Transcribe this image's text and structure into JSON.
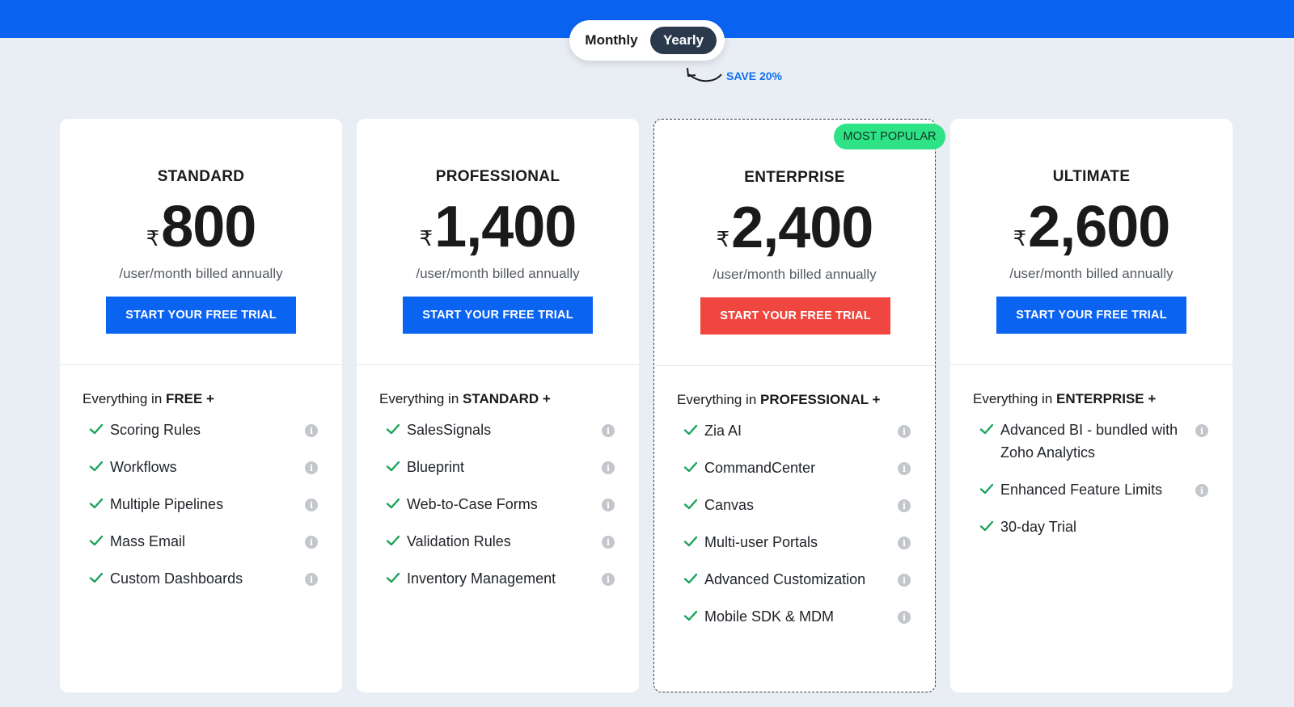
{
  "toggle": {
    "monthly": "Monthly",
    "yearly": "Yearly",
    "selected": "Yearly"
  },
  "save_label": "SAVE 20%",
  "plans": [
    {
      "name": "STANDARD",
      "currency": "₹",
      "price": "800",
      "billing": "/user/month billed annually",
      "cta": "START YOUR FREE TRIAL",
      "intro_prefix": "Everything in ",
      "intro_bold": "FREE +",
      "features": [
        "Scoring Rules",
        "Workflows",
        "Multiple Pipelines",
        "Mass Email",
        "Custom Dashboards"
      ]
    },
    {
      "name": "PROFESSIONAL",
      "currency": "₹",
      "price": "1,400",
      "billing": "/user/month billed annually",
      "cta": "START YOUR FREE TRIAL",
      "intro_prefix": "Everything in ",
      "intro_bold": "STANDARD +",
      "features": [
        "SalesSignals",
        "Blueprint",
        "Web-to-Case Forms",
        "Validation Rules",
        "Inventory Management"
      ]
    },
    {
      "name": "ENTERPRISE",
      "badge": "MOST POPULAR",
      "currency": "₹",
      "price": "2,400",
      "billing": "/user/month billed annually",
      "cta": "START YOUR FREE TRIAL",
      "intro_prefix": "Everything in ",
      "intro_bold": "PROFESSIONAL +",
      "features": [
        "Zia AI",
        "CommandCenter",
        "Canvas",
        "Multi-user Portals",
        "Advanced Customization",
        "Mobile SDK & MDM"
      ]
    },
    {
      "name": "ULTIMATE",
      "currency": "₹",
      "price": "2,600",
      "billing": "/user/month billed annually",
      "cta": "START YOUR FREE TRIAL",
      "intro_prefix": "Everything in ",
      "intro_bold": "ENTERPRISE +",
      "features": [
        "Advanced BI - bundled with Zoho Analytics",
        "Enhanced Feature Limits",
        "30-day Trial"
      ]
    }
  ],
  "icons": {
    "check": "check-icon",
    "info": "info-icon",
    "arrow": "curved-arrow-icon"
  },
  "colors": {
    "accent_blue": "#0b63f2",
    "cta_red": "#ef463f",
    "badge_green": "#2ee386",
    "check_green": "#1aa35b"
  }
}
